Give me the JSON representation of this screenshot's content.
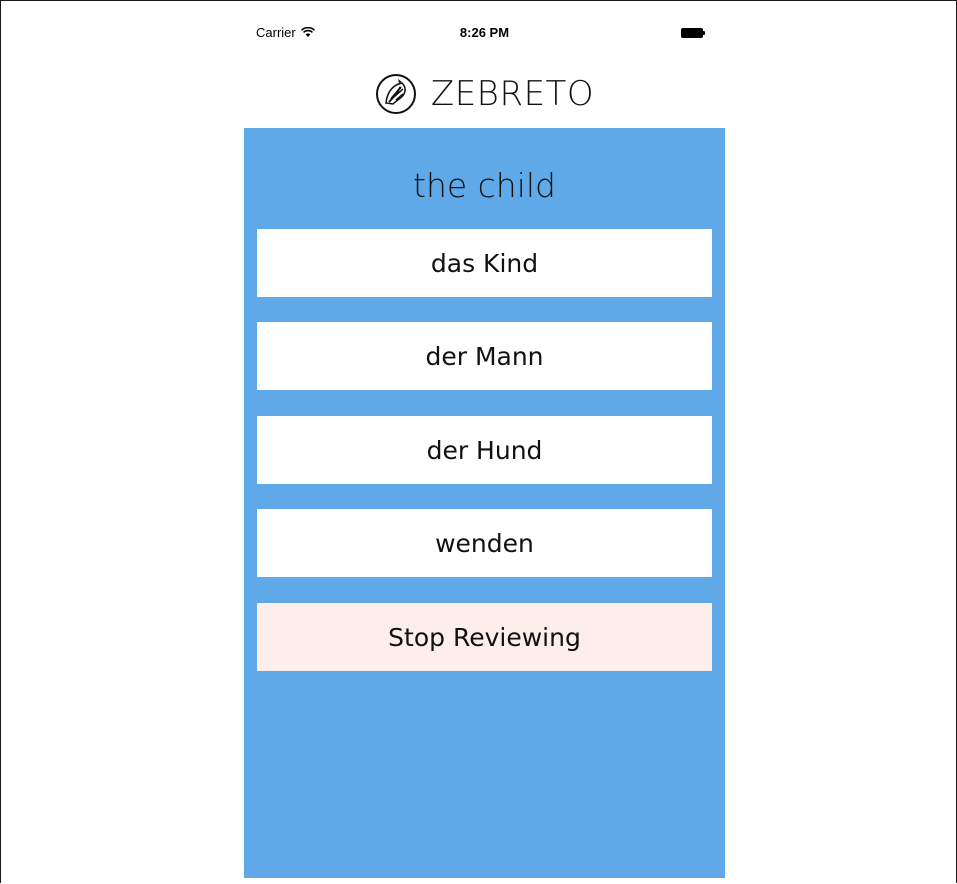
{
  "status_bar": {
    "carrier": "Carrier",
    "time": "8:26 PM"
  },
  "app": {
    "title": "ZEBRETO",
    "logo_icon": "zebra-head-icon"
  },
  "quiz": {
    "prompt": "the child",
    "options": [
      "das Kind",
      "der Mann",
      "der Hund",
      "wenden"
    ],
    "stop_label": "Stop Reviewing"
  },
  "colors": {
    "panel_background": "#5fa9e8",
    "option_background": "#ffffff",
    "stop_background": "#fdeee9"
  }
}
